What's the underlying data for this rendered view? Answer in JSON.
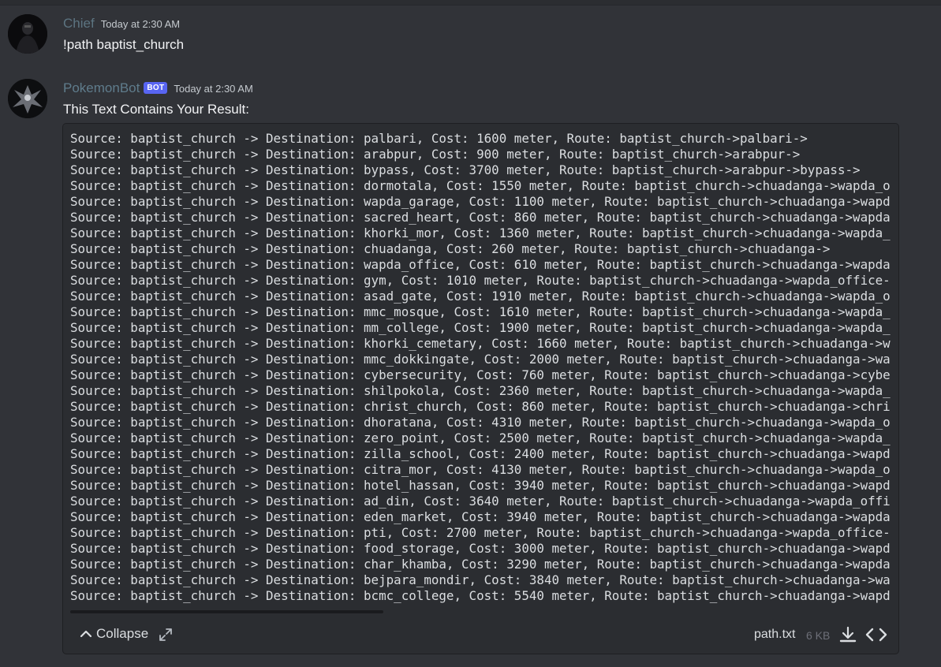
{
  "messages": [
    {
      "author": "Chief",
      "timestamp": "Today at 2:30 AM",
      "text": "!path baptist_church"
    },
    {
      "author": "PokemonBot",
      "badge": "BOT",
      "timestamp": "Today at 2:30 AM",
      "text": "This Text Contains Your Result:"
    }
  ],
  "attachment": {
    "lines": [
      "Source: baptist_church -> Destination: palbari, Cost: 1600 meter, Route: baptist_church->palbari->",
      "Source: baptist_church -> Destination: arabpur, Cost: 900 meter, Route: baptist_church->arabpur->",
      "Source: baptist_church -> Destination: bypass, Cost: 3700 meter, Route: baptist_church->arabpur->bypass->",
      "Source: baptist_church -> Destination: dormotala, Cost: 1550 meter, Route: baptist_church->chuadanga->wapda_o",
      "Source: baptist_church -> Destination: wapda_garage, Cost: 1100 meter, Route: baptist_church->chuadanga->wapd",
      "Source: baptist_church -> Destination: sacred_heart, Cost: 860 meter, Route: baptist_church->chuadanga->wapda",
      "Source: baptist_church -> Destination: khorki_mor, Cost: 1360 meter, Route: baptist_church->chuadanga->wapda_",
      "Source: baptist_church -> Destination: chuadanga, Cost: 260 meter, Route: baptist_church->chuadanga->",
      "Source: baptist_church -> Destination: wapda_office, Cost: 610 meter, Route: baptist_church->chuadanga->wapda",
      "Source: baptist_church -> Destination: gym, Cost: 1010 meter, Route: baptist_church->chuadanga->wapda_office-",
      "Source: baptist_church -> Destination: asad_gate, Cost: 1910 meter, Route: baptist_church->chuadanga->wapda_o",
      "Source: baptist_church -> Destination: mmc_mosque, Cost: 1610 meter, Route: baptist_church->chuadanga->wapda_",
      "Source: baptist_church -> Destination: mm_college, Cost: 1900 meter, Route: baptist_church->chuadanga->wapda_",
      "Source: baptist_church -> Destination: khorki_cemetary, Cost: 1660 meter, Route: baptist_church->chuadanga->w",
      "Source: baptist_church -> Destination: mmc_dokkingate, Cost: 2000 meter, Route: baptist_church->chuadanga->wa",
      "Source: baptist_church -> Destination: cybersecurity, Cost: 760 meter, Route: baptist_church->chuadanga->cybe",
      "Source: baptist_church -> Destination: shilpokola, Cost: 2360 meter, Route: baptist_church->chuadanga->wapda_",
      "Source: baptist_church -> Destination: christ_church, Cost: 860 meter, Route: baptist_church->chuadanga->chri",
      "Source: baptist_church -> Destination: dhoratana, Cost: 4310 meter, Route: baptist_church->chuadanga->wapda_o",
      "Source: baptist_church -> Destination: zero_point, Cost: 2500 meter, Route: baptist_church->chuadanga->wapda_",
      "Source: baptist_church -> Destination: zilla_school, Cost: 2400 meter, Route: baptist_church->chuadanga->wapd",
      "Source: baptist_church -> Destination: citra_mor, Cost: 4130 meter, Route: baptist_church->chuadanga->wapda_o",
      "Source: baptist_church -> Destination: hotel_hassan, Cost: 3940 meter, Route: baptist_church->chuadanga->wapd",
      "Source: baptist_church -> Destination: ad_din, Cost: 3640 meter, Route: baptist_church->chuadanga->wapda_offi",
      "Source: baptist_church -> Destination: eden_market, Cost: 3940 meter, Route: baptist_church->chuadanga->wapda",
      "Source: baptist_church -> Destination: pti, Cost: 2700 meter, Route: baptist_church->chuadanga->wapda_office-",
      "Source: baptist_church -> Destination: food_storage, Cost: 3000 meter, Route: baptist_church->chuadanga->wapd",
      "Source: baptist_church -> Destination: char_khamba, Cost: 3290 meter, Route: baptist_church->chuadanga->wapda",
      "Source: baptist_church -> Destination: bejpara_mondir, Cost: 3840 meter, Route: baptist_church->chuadanga->wa",
      "Source: baptist_church -> Destination: bcmc_college, Cost: 5540 meter, Route: baptist_church->chuadanga->wapd"
    ],
    "collapse_label": "Collapse",
    "filename": "path.txt",
    "filesize": "6 KB",
    "icons": {
      "collapse": "chevron-up-icon",
      "expand": "expand-icon",
      "download": "download-icon",
      "code": "code-icon"
    }
  },
  "colors": {
    "background": "#313338",
    "code_background": "#2b2d31",
    "bot_badge": "#5865f2"
  }
}
